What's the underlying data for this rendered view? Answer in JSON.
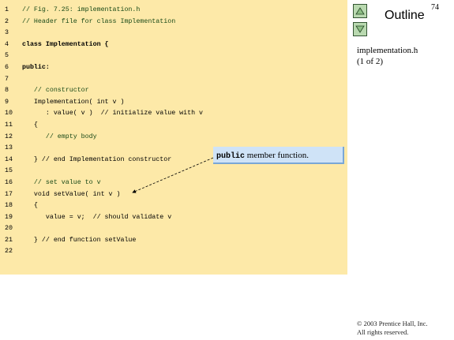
{
  "page_number": "74",
  "outline": {
    "title": "Outline",
    "up_icon": "triangle-up-icon",
    "down_icon": "triangle-down-icon"
  },
  "file_info": {
    "filename": "implementation.h",
    "part": "(1 of 2)"
  },
  "code_lines": [
    {
      "num": "1",
      "text": "// Fig. 7.25: implementation.h",
      "kind": "comment"
    },
    {
      "num": "2",
      "text": "// Header file for class Implementation",
      "kind": "comment"
    },
    {
      "num": "3",
      "text": "",
      "kind": "plain"
    },
    {
      "num": "4",
      "text": "class Implementation {",
      "kind": "kw"
    },
    {
      "num": "5",
      "text": "",
      "kind": "plain"
    },
    {
      "num": "6",
      "text": "public:",
      "kind": "kw"
    },
    {
      "num": "7",
      "text": "",
      "kind": "plain"
    },
    {
      "num": "8",
      "text": "   // constructor",
      "kind": "comment"
    },
    {
      "num": "9",
      "text": "   Implementation( int v )",
      "kind": "plain"
    },
    {
      "num": "10",
      "text": "      : value( v )  // initialize value with v",
      "kind": "plain"
    },
    {
      "num": "11",
      "text": "   {",
      "kind": "plain"
    },
    {
      "num": "12",
      "text": "      // empty body",
      "kind": "comment"
    },
    {
      "num": "13",
      "text": "",
      "kind": "plain"
    },
    {
      "num": "14",
      "text": "   } // end Implementation constructor",
      "kind": "plain"
    },
    {
      "num": "15",
      "text": "",
      "kind": "plain"
    },
    {
      "num": "16",
      "text": "   // set value to v",
      "kind": "comment"
    },
    {
      "num": "17",
      "text": "   void setValue( int v )",
      "kind": "plain"
    },
    {
      "num": "18",
      "text": "   {",
      "kind": "plain"
    },
    {
      "num": "19",
      "text": "      value = v;  // should validate v",
      "kind": "plain"
    },
    {
      "num": "20",
      "text": "",
      "kind": "plain"
    },
    {
      "num": "21",
      "text": "   } // end function setValue",
      "kind": "plain"
    },
    {
      "num": "22",
      "text": "",
      "kind": "plain"
    }
  ],
  "callout": {
    "keyword": "public",
    "text": " member function."
  },
  "copyright": {
    "line1": "© 2003 Prentice Hall, Inc.",
    "line2": "All rights reserved."
  },
  "colors": {
    "code_background": "#fde9a8",
    "callout_background": "#cfe3f7",
    "nav_button": "#b9d9b0"
  }
}
